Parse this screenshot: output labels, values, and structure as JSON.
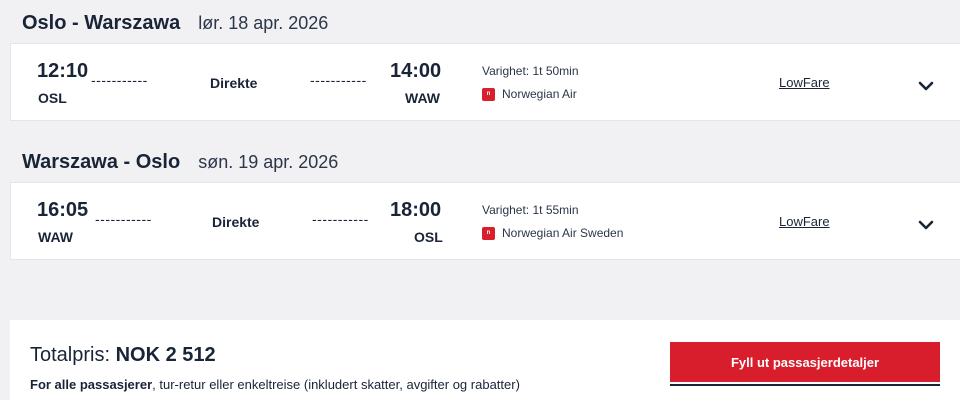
{
  "legs": [
    {
      "route": "Oslo - Warszawa",
      "date": "lør. 18 apr. 2026",
      "departure_time": "12:10",
      "departure_code": "OSL",
      "arrival_time": "14:00",
      "arrival_code": "WAW",
      "dashes_left": "-----------",
      "dashes_right": "-----------",
      "stops": "Direkte",
      "duration": "Varighet: 1t 50min",
      "airline": "Norwegian Air",
      "fare": "LowFare",
      "airline_logo_icon": "norwegian-logo-icon",
      "expand_icon": "chevron-down-icon"
    },
    {
      "route": "Warszawa - Oslo",
      "date": "søn. 19 apr. 2026",
      "departure_time": "16:05",
      "departure_code": "WAW",
      "arrival_time": "18:00",
      "arrival_code": "OSL",
      "dashes_left": "-----------",
      "dashes_right": "-----------",
      "stops": "Direkte",
      "duration": "Varighet: 1t 55min",
      "airline": "Norwegian Air Sweden",
      "fare": "LowFare",
      "airline_logo_icon": "norwegian-logo-icon",
      "expand_icon": "chevron-down-icon"
    }
  ],
  "footer": {
    "total_label": "Totalpris:",
    "total_value": "NOK 2 512",
    "note_bold": "For alle passasjerer",
    "note_rest": ", tur-retur eller enkeltreise (inkludert skatter, avgifter og rabatter)",
    "cta_label": "Fyll ut passasjerdetaljer"
  },
  "colors": {
    "accent": "#d81e2c",
    "text": "#1a2437",
    "background": "#f1f1f3"
  }
}
